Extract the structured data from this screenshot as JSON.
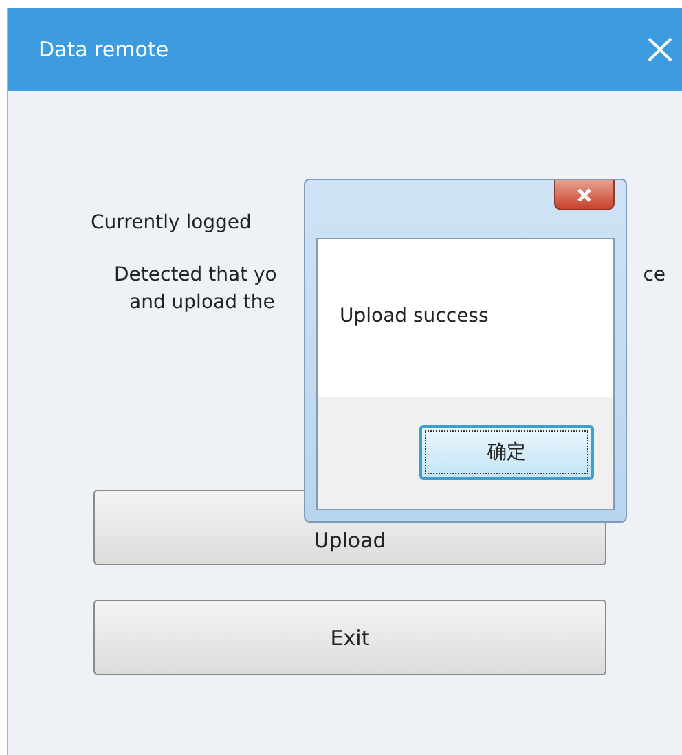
{
  "window": {
    "title": "Data remote"
  },
  "body": {
    "logged_line": "Currently logged",
    "detected_line_start": "Detected that yo",
    "detected_line_end": "ce",
    "upload_line": "and upload the"
  },
  "buttons": [
    {
      "label": "Upload"
    },
    {
      "label": "Exit"
    }
  ],
  "popup": {
    "message": "Upload success",
    "ok_button": "确定"
  }
}
